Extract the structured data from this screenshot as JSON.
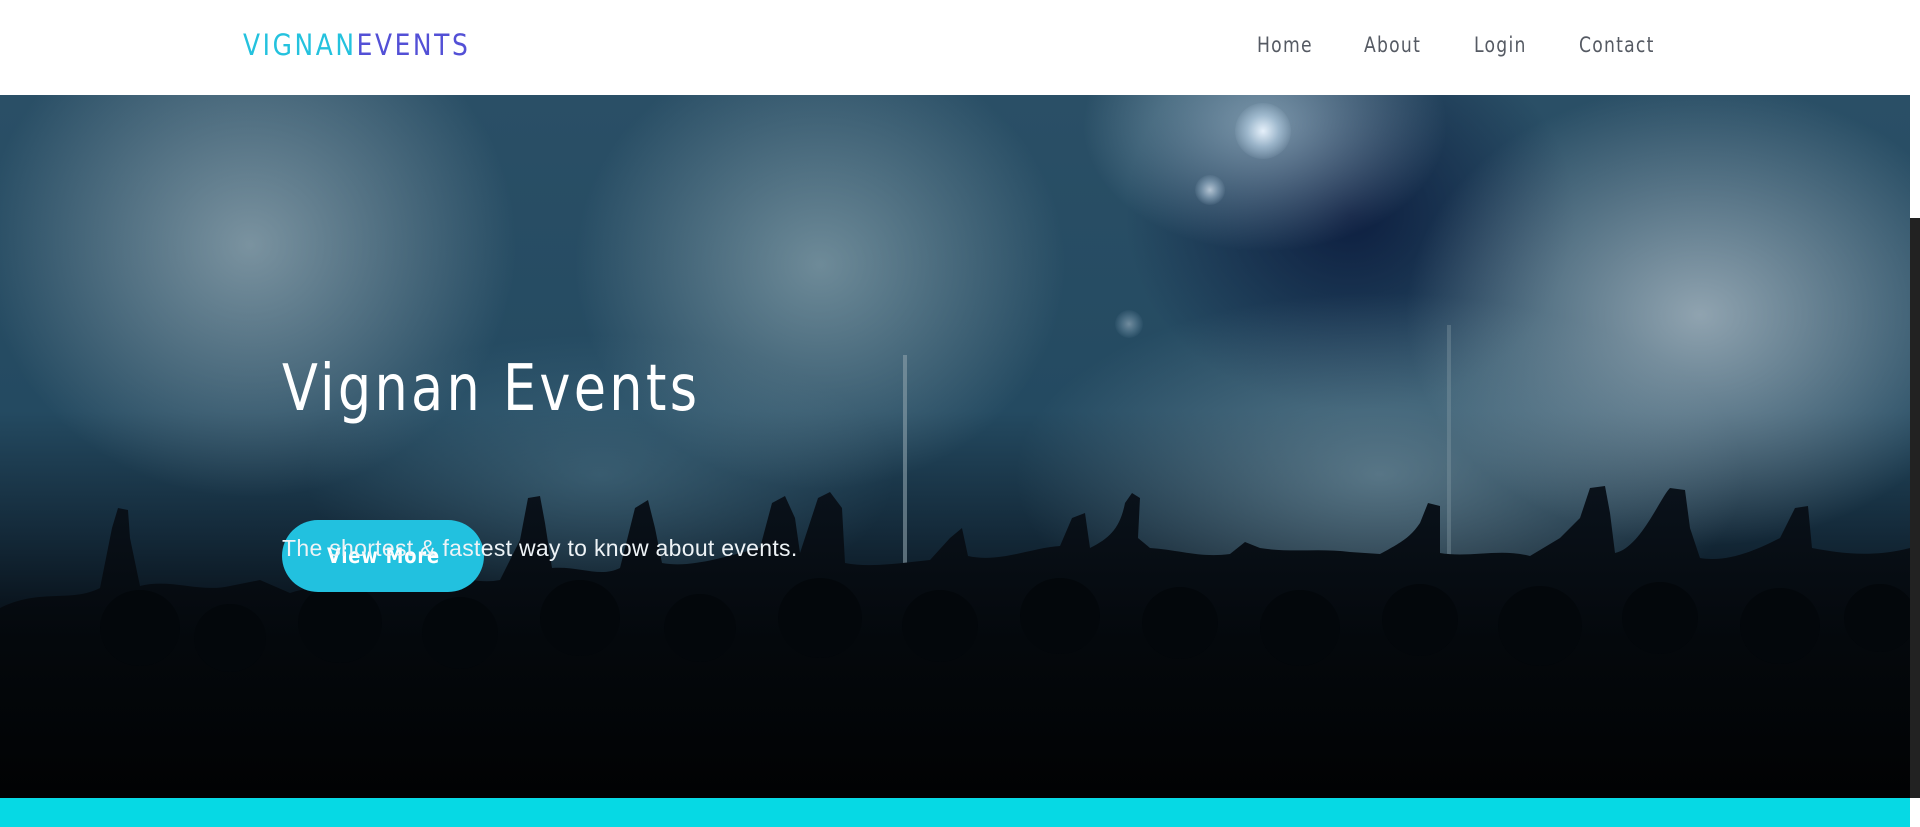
{
  "header": {
    "logo_part1": "VIGNAN",
    "logo_part2": "EVENTS",
    "nav": {
      "home": "Home",
      "about": "About",
      "login": "Login",
      "contact": "Contact"
    }
  },
  "hero": {
    "title": "Vignan Events",
    "subtitle": "The shortest & fastest way to know about events.",
    "button_label": "View More"
  },
  "colors": {
    "accent_cyan": "#22c1df",
    "brand_purple": "#5350d6",
    "band_cyan": "#06d9e4",
    "nav_text": "#555a63"
  }
}
